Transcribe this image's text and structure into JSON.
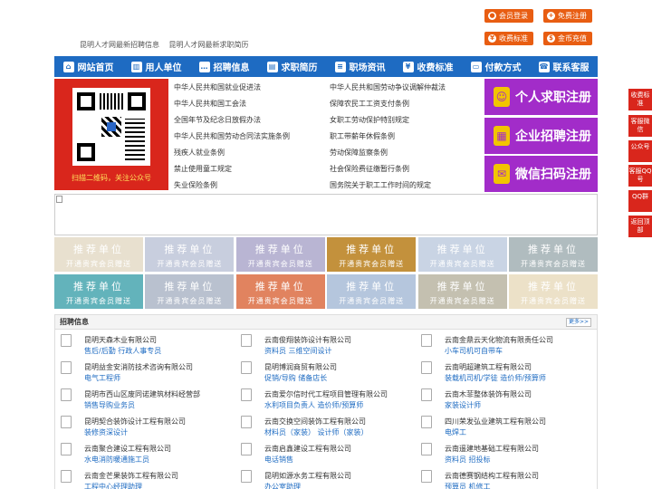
{
  "top_links": [
    "昆明人才网最新招聘信息",
    "昆明人才网最新求职简历"
  ],
  "top_buttons": [
    {
      "label": "会员登录",
      "icon": "user-icon"
    },
    {
      "label": "免费注册",
      "icon": "register-icon"
    },
    {
      "label": "收费标准",
      "icon": "yen-icon"
    },
    {
      "label": "金币充值",
      "icon": "coin-icon"
    }
  ],
  "nav": [
    {
      "label": "网站首页",
      "icon": "home-icon"
    },
    {
      "label": "用人单位",
      "icon": "building-icon"
    },
    {
      "label": "招聘信息",
      "icon": "chat-icon"
    },
    {
      "label": "求职简历",
      "icon": "resume-icon"
    },
    {
      "label": "职场资讯",
      "icon": "news-icon"
    },
    {
      "label": "收费标准",
      "icon": "yen-icon"
    },
    {
      "label": "付款方式",
      "icon": "card-icon"
    },
    {
      "label": "联系客服",
      "icon": "phone-icon"
    }
  ],
  "qr": {
    "caption": "扫描二维码，关注公众号"
  },
  "laws_left": [
    "中华人民共和国就业促进法",
    "中华人民共和国工会法",
    "全国年节及纪念日放假办法",
    "中华人民共和国劳动合同法实施条例",
    "残疾人就业条例",
    "禁止使用童工规定",
    "失业保险条例"
  ],
  "laws_right": [
    "中华人民共和国劳动争议调解仲裁法",
    "保障农民工工资支付条例",
    "女职工劳动保护特别规定",
    "职工带薪年休假条例",
    "劳动保障监察条例",
    "社会保险费征缴暂行条例",
    "国务院关于职工工作时间的规定"
  ],
  "register": [
    {
      "label": "个人求职注册",
      "icon": "person-icon"
    },
    {
      "label": "企业招聘注册",
      "icon": "company-icon"
    },
    {
      "label": "微信扫码注册",
      "icon": "wechat-icon"
    }
  ],
  "recommend": {
    "title": "推荐单位",
    "subtitle": "开通贵宾会员赠送",
    "colors": [
      "#e8e0cf",
      "#c8cede",
      "#b9b5d3",
      "#c3913c",
      "#c9d4e4",
      "#b0bcbf",
      "#63b3bb",
      "#b9c1cf",
      "#e1835f",
      "#b5c6dd",
      "#c4c0b0",
      "#ece1c8"
    ]
  },
  "jobs": {
    "title": "招聘信息",
    "more": "更多>>",
    "items": [
      {
        "name": "昆明天森木业有限公司",
        "pos": "售后/后勤 行政人事专员"
      },
      {
        "name": "云南俊翔装饰设计有限公司",
        "pos": "资料员 三维空间设计"
      },
      {
        "name": "云南金鼎云天化物流有限责任公司",
        "pos": "小车司机可自带车"
      },
      {
        "name": "昆明益金安消防技术咨询有限公司",
        "pos": "电气工程师"
      },
      {
        "name": "昆明博润商贸有限公司",
        "pos": "促销/导购 储备店长"
      },
      {
        "name": "云南明超建筑工程有限公司",
        "pos": "装载机司机/学徒 造价师/预算师"
      },
      {
        "name": "昆明市西山区废同诺建筑材料经营部",
        "pos": "销售导购业务员"
      },
      {
        "name": "云南爱尔信时代工程项目管理有限公司",
        "pos": "水利项目负责人 造价师/预算师"
      },
      {
        "name": "云南木菲整体装饰有限公司",
        "pos": "家装设计师"
      },
      {
        "name": "昆明契合装饰设计工程有限公司",
        "pos": "装修资深设计"
      },
      {
        "name": "云南交换空间装饰工程有限公司",
        "pos": "材料员（家装） 设计师（家装）"
      },
      {
        "name": "四川荣发弘业建筑工程有限公司",
        "pos": "电焊工"
      },
      {
        "name": "云南聚合建设工程有限公司",
        "pos": "水电消防暖通施工员"
      },
      {
        "name": "云南启鑫建设工程有限公司",
        "pos": "电话销售"
      },
      {
        "name": "云南遥建地基础工程有限公司",
        "pos": "资料员 招投标"
      },
      {
        "name": "云南金芒果装饰工程有限公司",
        "pos": "工程中心经理助理"
      },
      {
        "name": "昆明如源水务工程有限公司",
        "pos": "办公室助理"
      },
      {
        "name": "云南德赛钢结构工程有限公司",
        "pos": "预算员 机修工"
      }
    ]
  },
  "side": [
    "收费标准",
    "客服微信",
    "公众号",
    "客服QQ号",
    "QQ群",
    "返回顶部"
  ]
}
